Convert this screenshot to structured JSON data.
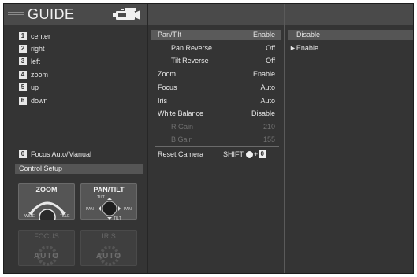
{
  "header": {
    "title": "GUIDE",
    "camera_icon": "video-camera-icon"
  },
  "left_menu": {
    "items": [
      {
        "num": "1",
        "label": "center"
      },
      {
        "num": "2",
        "label": "right"
      },
      {
        "num": "3",
        "label": "left"
      },
      {
        "num": "4",
        "label": "zoom"
      },
      {
        "num": "5",
        "label": "up"
      },
      {
        "num": "6",
        "label": "down"
      }
    ],
    "focus_item": {
      "num": "0",
      "label": "Focus Auto/Manual"
    },
    "control_setup": "Control Setup"
  },
  "control_panels": {
    "zoom": {
      "title": "ZOOM",
      "wide": "WIDE",
      "tele": "TELE"
    },
    "pantilt": {
      "title": "PAN/TILT",
      "tilt_top": "TILT",
      "tilt_bottom": "TILT",
      "pan_left": "PAN",
      "pan_right": "PAN"
    },
    "focus": {
      "title": "FOCUS",
      "value": "AUTO"
    },
    "iris": {
      "title": "IRIS",
      "value": "AUTO"
    }
  },
  "settings_menu": {
    "rows": [
      {
        "label": "Pan/Tilt",
        "value": "Enable",
        "indent": false,
        "dim": false,
        "selected": true
      },
      {
        "label": "Pan Reverse",
        "value": "Off",
        "indent": true,
        "dim": false
      },
      {
        "label": "Tilt Reverse",
        "value": "Off",
        "indent": true,
        "dim": false
      },
      {
        "label": "Zoom",
        "value": "Enable",
        "indent": false,
        "dim": false
      },
      {
        "label": "Focus",
        "value": "Auto",
        "indent": false,
        "dim": false
      },
      {
        "label": "Iris",
        "value": "Auto",
        "indent": false,
        "dim": false
      },
      {
        "label": "White Balance",
        "value": "Disable",
        "indent": false,
        "dim": false
      },
      {
        "label": "R Gain",
        "value": "210",
        "indent": true,
        "dim": true
      },
      {
        "label": "B Gain",
        "value": "155",
        "indent": true,
        "dim": true
      }
    ],
    "reset": {
      "label": "Reset Camera",
      "shift": "SHIFT",
      "plus": "+",
      "key": "0"
    }
  },
  "options": {
    "items": [
      {
        "label": "Disable",
        "highlighted": true
      },
      {
        "label": "Enable",
        "marker": "►"
      }
    ]
  }
}
